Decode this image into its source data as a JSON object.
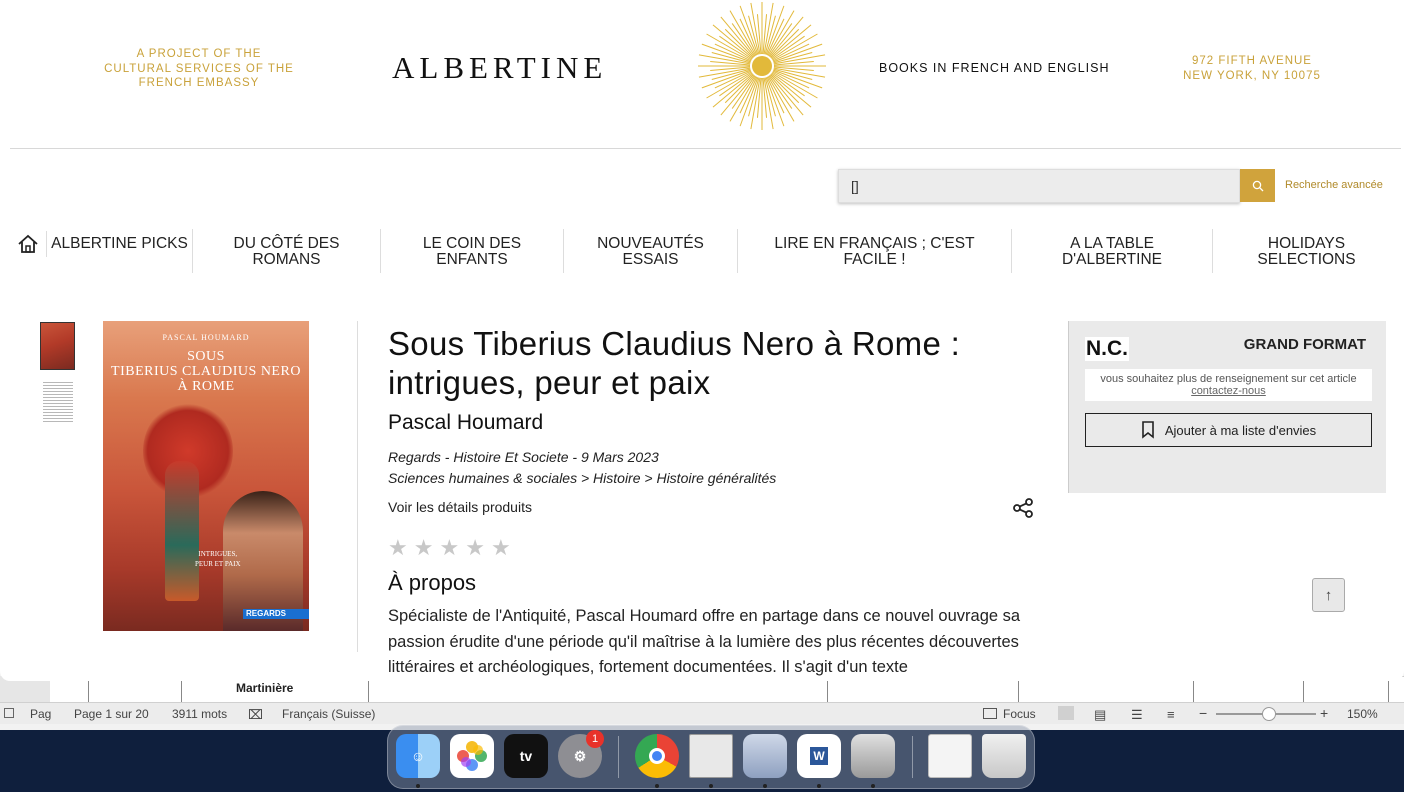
{
  "header": {
    "project_line1": "A PROJECT OF THE",
    "project_line2": "CULTURAL SERVICES OF THE",
    "project_line3": "FRENCH EMBASSY",
    "logo": "ALBERTINE",
    "books": "BOOKS IN FRENCH AND ENGLISH",
    "address_line1": "972 FIFTH AVENUE",
    "address_line2": "NEW YORK, NY 10075",
    "accent_color": "#c9a23a"
  },
  "search": {
    "value": "[]",
    "advanced_label": "Recherche avancée"
  },
  "nav": {
    "items": [
      {
        "label": "ALBERTINE PICKS"
      },
      {
        "label": "DU CÔTÉ DES ROMANS"
      },
      {
        "label": "LE COIN DES ENFANTS"
      },
      {
        "label": "NOUVEAUTÉS ESSAIS"
      },
      {
        "label": "LIRE EN FRANÇAIS ; C'EST FACILE !"
      },
      {
        "label": "A LA TABLE D'ALBERTINE"
      },
      {
        "label": "HOLIDAYS SELECTIONS"
      }
    ]
  },
  "cover": {
    "author": "PASCAL HOUMARD",
    "title_line1": "SOUS",
    "title_line2": "TIBERIUS CLAUDIUS NERO",
    "title_line3": "À ROME",
    "subtitle_line1": "INTRIGUES,",
    "subtitle_line2": "PEUR ET PAIX",
    "publisher": "REGARDS"
  },
  "product": {
    "title": "Sous Tiberius Claudius Nero à Rome : intrigues, peur et paix",
    "author": "Pascal Houmard",
    "meta_line": "Regards - Histoire Et Societe - 9 Mars 2023",
    "categories": "Sciences humaines & sociales > Histoire > Histoire généralités",
    "details_link": "Voir les détails produits",
    "rating": 0,
    "about_heading": "À propos",
    "description": "Spécialiste de l'Antiquité, Pascal Houmard offre en partage dans ce nouvel ouvrage sa passion érudite d'une période qu'il maîtrise à la lumière des plus récentes découvertes littéraires et archéologiques, fortement documentées. Il s'agit d'un texte"
  },
  "side_panel": {
    "price": "N.C.",
    "format": "GRAND FORMAT",
    "info_text": "vous souhaitez plus de renseignement sur cet article",
    "contact_link": "contactez-nous",
    "wishlist_label": "Ajouter à ma liste d'envies"
  },
  "word": {
    "table_text": "Martinière",
    "left_label": "Pag",
    "page_info": "Page 1 sur 20",
    "word_count": "3911 mots",
    "language": "Français (Suisse)",
    "focus_label": "Focus",
    "zoom": "150%"
  },
  "dock": {
    "settings_badge": "1",
    "tv_label": "tv"
  }
}
